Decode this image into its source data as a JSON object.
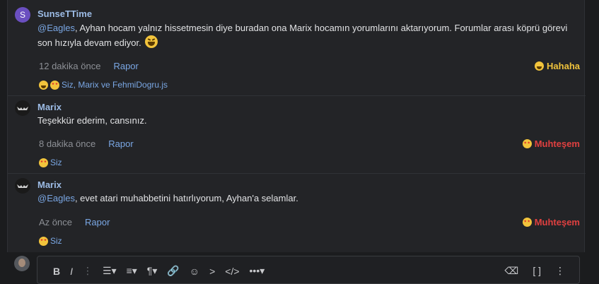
{
  "messages": [
    {
      "author": "SunseTTime",
      "avatar_letter": "S",
      "mention": "@Eagles",
      "text": ", Ayhan hocam yalnız hissetmesin diye buradan ona Marix hocamın yorumlarını aktarıyorum. Forumlar arası köprü görevi son hızıyla devam ediyor.",
      "time": "12 dakika önce",
      "report": "Rapor",
      "reaction_label": "Hahaha",
      "reactors": "Siz, Marix ve FehmiDogru.js"
    },
    {
      "author": "Marix",
      "text": "Teşekkür ederim, cansınız.",
      "time": "8 dakika önce",
      "report": "Rapor",
      "reaction_label": "Muhteşem",
      "reactors": "Siz"
    },
    {
      "author": "Marix",
      "mention": "@Eagles",
      "text": ", evet atari muhabbetini hatırlıyorum, Ayhan'a selamlar.",
      "time": "Az önce",
      "report": "Rapor",
      "reaction_label": "Muhteşem",
      "reactors": "Siz"
    }
  ],
  "editor": {
    "toolbar": [
      "B",
      "I",
      "⋮",
      "☰▾",
      "≡▾",
      "¶▾",
      "🔗",
      "☺",
      ">",
      "</>",
      "•••▾"
    ],
    "toolbar_right": [
      "⌫",
      "[ ]",
      "⋮"
    ]
  },
  "colors": {
    "link": "#7aa7e4",
    "haha": "#f0c33c",
    "wow": "#e04040"
  }
}
